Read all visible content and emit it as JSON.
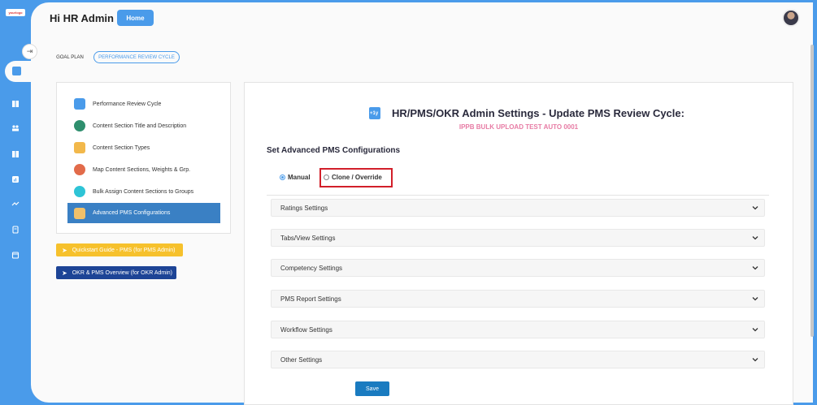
{
  "app": {
    "logo_text": "yourlogo"
  },
  "header": {
    "greeting": "Hi HR Admin",
    "home_label": "Home"
  },
  "breadcrumb": {
    "goal_plan": "GOAL PLAN",
    "performance_review_cycle": "PERFORMANCE REVIEW CYCLE"
  },
  "menu": {
    "items": [
      {
        "label": "Performance Review Cycle",
        "icon": "calendar-plus-icon",
        "color": "#4a9bea"
      },
      {
        "label": "Content Section Title and Description",
        "icon": "dots-icon",
        "color": "#2f8f6e"
      },
      {
        "label": "Content Section Types",
        "icon": "shapes-icon",
        "color": "#f2b84b"
      },
      {
        "label": "Map Content Sections, Weights & Grp.",
        "icon": "user-map-icon",
        "color": "#e26b4a"
      },
      {
        "label": "Bulk Assign Content Sections to Groups",
        "icon": "group-icon",
        "color": "#2ec4d6"
      },
      {
        "label": "Advanced PMS Configurations",
        "icon": "config-icon",
        "color": "#f0c06a",
        "active": true
      }
    ]
  },
  "guides": {
    "quickstart": "Quickstart Guide - PMS (for PMS Admin)",
    "okr_overview": "OKR & PMS Overview (for OKR Admin)"
  },
  "panel": {
    "title": "HR/PMS/OKR Admin Settings - Update PMS Review Cycle:",
    "subtitle": "IPPB BULK UPLOAD TEST AUTO 0001",
    "section_heading": "Set Advanced PMS Configurations",
    "radio": {
      "manual": "Manual",
      "clone": "Clone / Override",
      "selected": "Manual"
    },
    "accordions": [
      "Ratings Settings",
      "Tabs/View Settings",
      "Competency Settings",
      "PMS Report Settings",
      "Workflow Settings",
      "Other Settings"
    ],
    "save_label": "Save"
  },
  "colors": {
    "accent": "#4a9bea",
    "active_menu": "#3a80c4",
    "subtitle": "#e77ba4",
    "highlight_frame": "#d21f2a"
  }
}
